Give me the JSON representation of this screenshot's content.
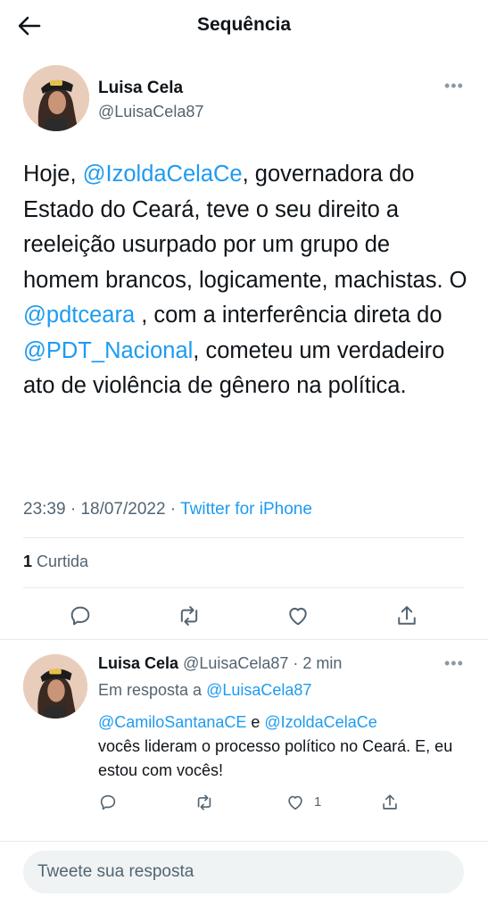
{
  "header": {
    "title": "Sequência",
    "back_icon": "arrow-left-icon"
  },
  "tweet": {
    "author": {
      "name": "Luisa Cela",
      "handle": "@LuisaCela87"
    },
    "more_icon": "more-horizontal-icon",
    "segments": [
      {
        "text": "Hoje, ",
        "mention": false
      },
      {
        "text": "@IzoldaCelaCe",
        "mention": true
      },
      {
        "text": ", governadora do Estado do Ceará, teve o seu direito a reeleição usurpado por um grupo de homem brancos, logicamente, machistas. O ",
        "mention": false
      },
      {
        "text": "@pdtceara",
        "mention": true
      },
      {
        "text": " , com a interferência direta do ",
        "mention": false
      },
      {
        "text": "@PDT_Nacional",
        "mention": true
      },
      {
        "text": ", cometeu um verdadeiro ato de violência de gênero na política.",
        "mention": false
      }
    ],
    "time": "23:39",
    "date": "18/07/2022",
    "separator": " · ",
    "source": "Twitter for iPhone",
    "likes_count": "1",
    "likes_label": " Curtida",
    "actions": [
      "reply-icon",
      "retweet-icon",
      "like-icon",
      "share-icon"
    ]
  },
  "reply": {
    "name": "Luisa Cela",
    "handle": "@LuisaCela87",
    "time": " · 2 min",
    "replying_prefix": "Em resposta a ",
    "replying_to": "@LuisaCela87",
    "mention1": "@CamiloSantanaCE",
    "joiner": " e ",
    "mention2": "@IzoldaCelaCe",
    "text": "vocês lideram o processo político no Ceará. E, eu estou com vocês!",
    "like_count": "1"
  },
  "compose": {
    "placeholder": "Tweete sua resposta"
  },
  "colors": {
    "accent": "#1d9bf0",
    "secondary_text": "#536471",
    "divider": "#e6e9eb"
  }
}
